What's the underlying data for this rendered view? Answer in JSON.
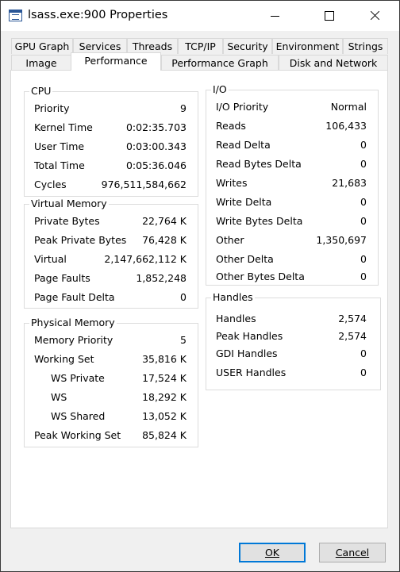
{
  "window": {
    "title": "lsass.exe:900 Properties"
  },
  "tabs_row1": [
    "GPU Graph",
    "Services",
    "Threads",
    "TCP/IP",
    "Security",
    "Environment",
    "Strings"
  ],
  "tabs_row2": [
    "Image",
    "Performance",
    "Performance Graph",
    "Disk and Network"
  ],
  "active_tab": "Performance",
  "cpu": {
    "title": "CPU",
    "rows": [
      {
        "label": "Priority",
        "value": "9"
      },
      {
        "label": "Kernel Time",
        "value": "0:02:35.703"
      },
      {
        "label": "User Time",
        "value": "0:03:00.343"
      },
      {
        "label": "Total Time",
        "value": "0:05:36.046"
      },
      {
        "label": "Cycles",
        "value": "976,511,584,662"
      }
    ]
  },
  "virtual_memory": {
    "title": "Virtual Memory",
    "rows": [
      {
        "label": "Private Bytes",
        "value": "22,764 K"
      },
      {
        "label": "Peak Private Bytes",
        "value": "76,428 K"
      },
      {
        "label": "Virtual",
        "value": "2,147,662,112 K"
      },
      {
        "label": "Page Faults",
        "value": "1,852,248"
      },
      {
        "label": "Page Fault Delta",
        "value": "0"
      }
    ]
  },
  "physical_memory": {
    "title": "Physical Memory",
    "rows": [
      {
        "label": "Memory Priority",
        "value": "5"
      },
      {
        "label": "Working Set",
        "value": "35,816 K"
      },
      {
        "label": "WS Private",
        "value": "17,524 K"
      },
      {
        "label": "WS",
        "value": "18,292 K"
      },
      {
        "label": "WS Shared",
        "value": "13,052 K"
      },
      {
        "label": "Peak Working Set",
        "value": "85,824 K"
      }
    ]
  },
  "io": {
    "title": "I/O",
    "rows": [
      {
        "label": "I/O Priority",
        "value": "Normal"
      },
      {
        "label": "Reads",
        "value": "106,433"
      },
      {
        "label": "Read Delta",
        "value": "0"
      },
      {
        "label": "Read Bytes Delta",
        "value": "0"
      },
      {
        "label": "Writes",
        "value": "21,683"
      },
      {
        "label": "Write Delta",
        "value": "0"
      },
      {
        "label": "Write Bytes Delta",
        "value": "0"
      },
      {
        "label": "Other",
        "value": "1,350,697"
      },
      {
        "label": "Other Delta",
        "value": "0"
      },
      {
        "label": "Other Bytes Delta",
        "value": "0"
      }
    ]
  },
  "handles": {
    "title": "Handles",
    "rows": [
      {
        "label": "Handles",
        "value": "2,574"
      },
      {
        "label": "Peak Handles",
        "value": "2,574"
      },
      {
        "label": "GDI Handles",
        "value": "0"
      },
      {
        "label": "USER Handles",
        "value": "0"
      }
    ]
  },
  "buttons": {
    "ok": "OK",
    "cancel": "Cancel"
  }
}
